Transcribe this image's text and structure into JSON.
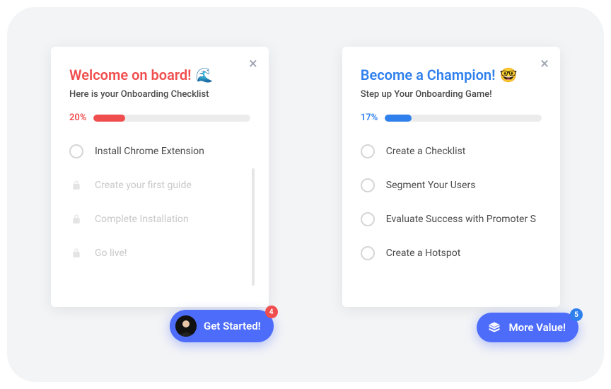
{
  "cards": [
    {
      "title": "Welcome on board!",
      "emoji": "🌊",
      "subtitle": "Here is your Onboarding Checklist",
      "progress_pct": "20%",
      "items": [
        {
          "label": "Install Chrome Extension",
          "locked": false
        },
        {
          "label": "Create your first guide",
          "locked": true
        },
        {
          "label": "Complete Installation",
          "locked": true
        },
        {
          "label": "Go live!",
          "locked": true
        }
      ],
      "cta": {
        "label": "Get Started!",
        "badge": "4"
      }
    },
    {
      "title": "Become a Champion!",
      "emoji": "🤓",
      "subtitle": "Step up Your Onboarding Game!",
      "progress_pct": "17%",
      "items": [
        {
          "label": "Create a Checklist",
          "locked": false
        },
        {
          "label": "Segment Your Users",
          "locked": false
        },
        {
          "label": "Evaluate Success with Promoter S",
          "locked": false
        },
        {
          "label": "Create a Hotspot",
          "locked": false
        }
      ],
      "cta": {
        "label": "More Value!",
        "badge": "5"
      }
    }
  ]
}
